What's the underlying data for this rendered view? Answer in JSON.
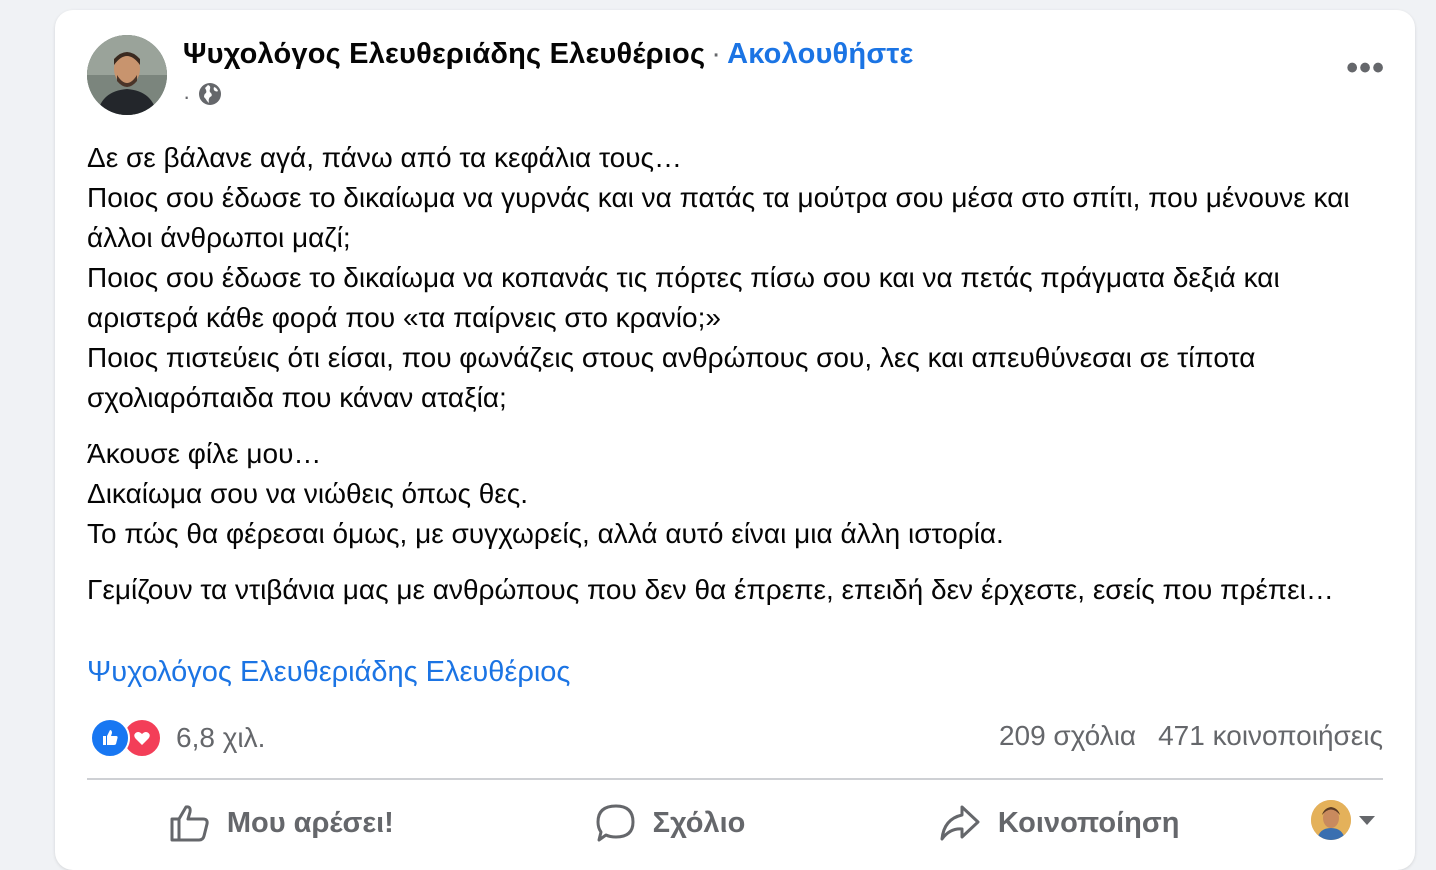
{
  "post": {
    "author": "Ψυχολόγος Ελευθεριάδης Ελευθέριος",
    "separator": "·",
    "follow_label": "Ακολουθήστε",
    "meta_separator": "·",
    "audience_icon": "globe-icon",
    "more_label": "•••",
    "paragraphs": [
      [
        "Δε σε βάλανε αγά, πάνω από τα κεφάλια τους…",
        "Ποιος σου έδωσε το δικαίωμα να γυρνάς και να πατάς τα μούτρα σου μέσα στο σπίτι, που μένουνε και άλλοι άνθρωποι μαζί;",
        "Ποιος σου έδωσε το δικαίωμα να κοπανάς τις πόρτες πίσω σου και να πετάς πράγματα δεξιά και αριστερά κάθε φορά που «τα παίρνεις στο κρανίο;»",
        "Ποιος πιστεύεις ότι είσαι, που φωνάζεις στους ανθρώπους σου, λες και απευθύνεσαι σε τίποτα σχολιαρόπαιδα που κάναν αταξία;"
      ],
      [
        "Άκουσε φίλε μου…",
        "Δικαίωμα σου να νιώθεις όπως θες.",
        "Το πώς θα φέρεσαι όμως, με συγχωρείς, αλλά αυτό είναι μια άλλη ιστορία."
      ],
      [
        "Γεμίζουν τα ντιβάνια μας με ανθρώπους που δεν θα έπρεπε, επειδή δεν έρχεστε, εσείς που πρέπει…"
      ]
    ],
    "tagline": "Ψυχολόγος Ελευθεριάδης Ελευθέριος"
  },
  "stats": {
    "reactions_count": "6,8 χιλ.",
    "comments": "209 σχόλια",
    "shares": "471 κοινοποιήσεις",
    "reaction_icons": [
      "like-icon",
      "love-icon"
    ],
    "colors": {
      "like": "#1877f2",
      "love": "#f33e58"
    }
  },
  "actions": {
    "like": "Μου αρέσει!",
    "comment": "Σχόλιο",
    "share": "Κοινοποίηση"
  },
  "colors": {
    "link": "#1b74e4",
    "muted": "#65676b",
    "background": "#f0f2f5"
  }
}
